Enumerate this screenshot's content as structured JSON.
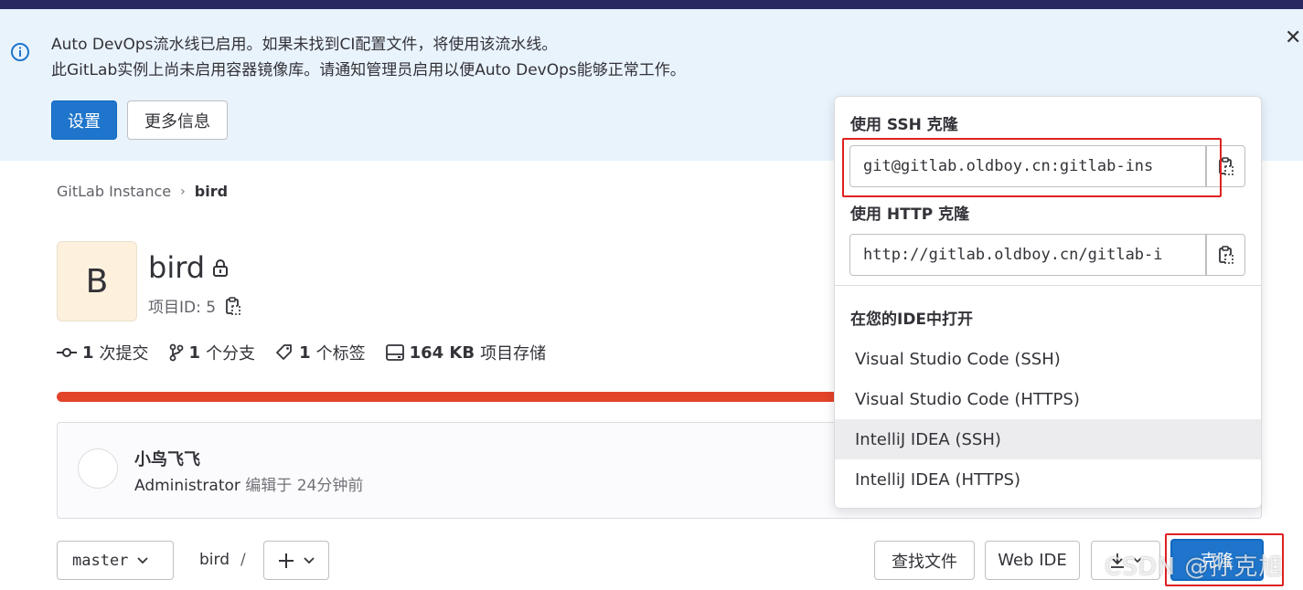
{
  "alert": {
    "line1": "Auto DevOps流水线已启用。如果未找到CI配置文件，将使用该流水线。",
    "line2": "此GitLab实例上尚未启用容器镜像库。请通知管理员启用以便Auto DevOps能够正常工作。",
    "settings_label": "设置",
    "more_info_label": "更多信息"
  },
  "breadcrumb": {
    "root": "GitLab Instance",
    "current": "bird"
  },
  "project": {
    "avatar_letter": "B",
    "name": "bird",
    "id_text": "项目ID: 5"
  },
  "stats": {
    "commits_count": "1",
    "commits_label": "次提交",
    "branches_count": "1",
    "branches_label": "个分支",
    "tags_count": "1",
    "tags_label": "个标签",
    "storage_size": "164 KB",
    "storage_label": "项目存储"
  },
  "commit": {
    "title": "小鸟飞飞",
    "author": "Administrator",
    "edited": "编辑于 24分钟前"
  },
  "toolbar": {
    "branch": "master",
    "path_root": "bird",
    "path_sep": "/",
    "find_file_label": "查找文件",
    "web_ide_label": "Web IDE",
    "clone_label": "克隆"
  },
  "clone_dropdown": {
    "ssh_label": "使用 SSH 克隆",
    "ssh_url": "git@gitlab.oldboy.cn:gitlab-ins",
    "http_label": "使用 HTTP 克隆",
    "http_url": "http://gitlab.oldboy.cn/gitlab-i",
    "ide_header": "在您的IDE中打开",
    "ide_items": [
      "Visual Studio Code (SSH)",
      "Visual Studio Code (HTTPS)",
      "IntelliJ IDEA (SSH)",
      "IntelliJ IDEA (HTTPS)"
    ]
  },
  "watermark": "CSDN @孙克旭",
  "colors": {
    "primary": "#1f75cb",
    "alert_bg": "#e9f3fc",
    "progress": "#e24329",
    "highlight_box": "#e02020"
  }
}
